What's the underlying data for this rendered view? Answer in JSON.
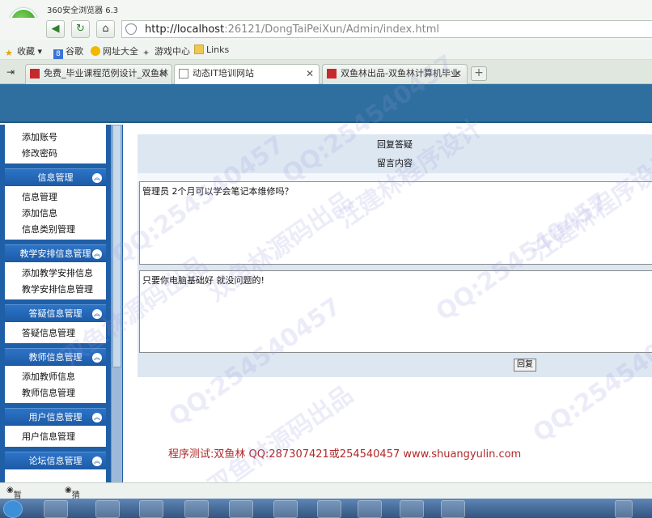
{
  "browser": {
    "app_title": "360安全浏览器 6.3",
    "url_host": "http://localhost",
    "url_path": ":26121/DongTaiPeiXun/Admin/index.html"
  },
  "favorites": {
    "collect": "收藏",
    "google": "谷歌",
    "site_nav": "网址大全",
    "games": "游戏中心",
    "links": "Links"
  },
  "tabs": [
    {
      "label": "免费_毕业课程范例设计_双鱼林"
    },
    {
      "label": "动态IT培训网站"
    },
    {
      "label": "双鱼林出品-双鱼林计算机毕业"
    }
  ],
  "sidebar": {
    "top_items": [
      "添加账号",
      "修改密码"
    ],
    "groups": [
      {
        "title": "信息管理",
        "items": [
          "信息管理",
          "添加信息",
          "信息类别管理"
        ]
      },
      {
        "title": "教学安排信息管理",
        "items": [
          "添加教学安排信息",
          "教学安排信息管理"
        ]
      },
      {
        "title": "答疑信息管理",
        "items": [
          "答疑信息管理"
        ]
      },
      {
        "title": "教师信息管理",
        "items": [
          "添加教师信息",
          "教师信息管理"
        ]
      },
      {
        "title": "用户信息管理",
        "items": [
          "用户信息管理"
        ]
      },
      {
        "title": "论坛信息管理",
        "items": []
      }
    ]
  },
  "main": {
    "heading": "回复答疑",
    "subheading": "留言内容",
    "message": "管理员  2个月可以学会笔记本维修吗？",
    "reply_text": "只要你电脑基础好 就没问题的!",
    "reply_button": "回复"
  },
  "credit": "程序测试:双鱼林 QQ:287307421或254540457 www.shuangyulin.com",
  "status": {
    "rating": "暂无点评",
    "guess": "猜你喜欢"
  },
  "watermarks": [
    "QQ:254540457",
    "双鱼林源码出品",
    "汪建林程序设计"
  ]
}
